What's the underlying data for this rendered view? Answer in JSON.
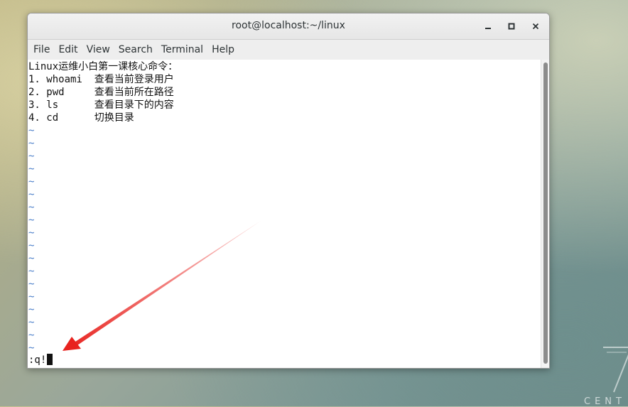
{
  "window": {
    "title": "root@localhost:~/linux"
  },
  "menu": {
    "items": [
      "File",
      "Edit",
      "View",
      "Search",
      "Terminal",
      "Help"
    ]
  },
  "editor": {
    "lines": [
      "Linux运维小白第一课核心命令：",
      "1. whoami  查看当前登录用户",
      "2. pwd     查看当前所在路径",
      "3. ls      查看目录下的内容",
      "4. cd      切换目录"
    ],
    "empty_line_marker": "~",
    "empty_line_count": 18,
    "command_line": ":q!"
  },
  "colors": {
    "annotation_arrow": "#e8231f",
    "tilde": "#4a7ec9"
  },
  "icons": {
    "minimize": "minimize-icon",
    "maximize": "maximize-icon",
    "close": "close-icon"
  }
}
